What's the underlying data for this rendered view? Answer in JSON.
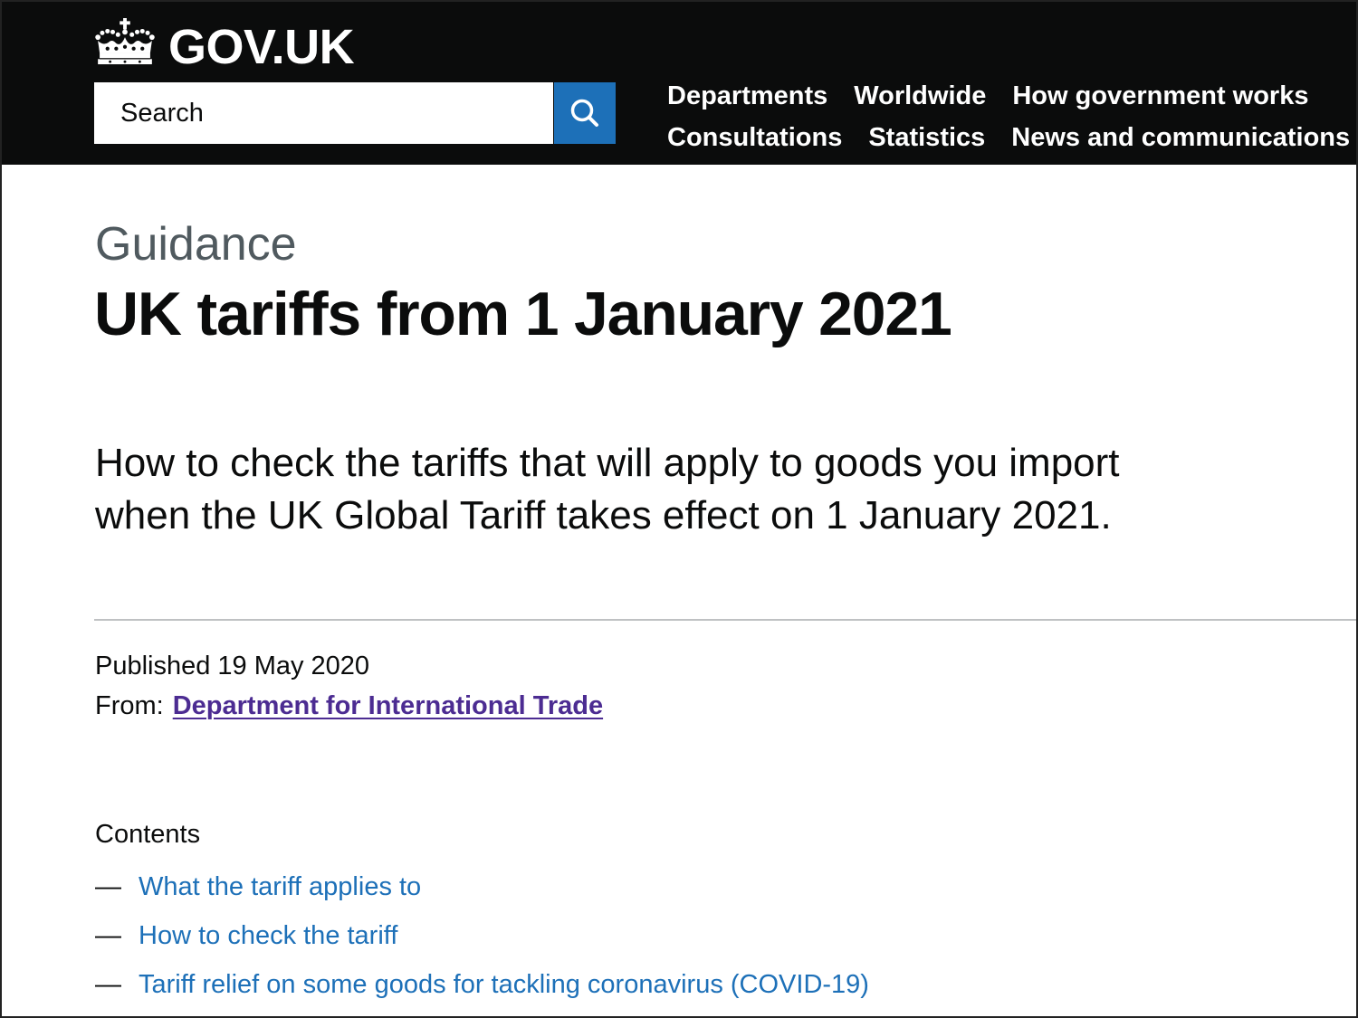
{
  "header": {
    "logo": {
      "text": "GOV.UK",
      "icon": "crown-icon"
    },
    "search": {
      "placeholder": "Search",
      "button_icon": "search-icon"
    },
    "nav": {
      "items": [
        {
          "label": "Departments"
        },
        {
          "label": "Worldwide"
        },
        {
          "label": "How government works"
        },
        {
          "label": "Consultations"
        },
        {
          "label": "Statistics"
        },
        {
          "label": "News and communications"
        }
      ]
    }
  },
  "main": {
    "document_type": "Guidance",
    "title": "UK tariffs from 1 January 2021",
    "description": "How to check the tariffs that will apply to goods you import when the UK Global Tariff takes effect on 1 January 2021.",
    "metadata": {
      "published_label": "Published",
      "published_date": "19 May 2020",
      "from_label": "From:",
      "from_organisation": "Department for International Trade"
    },
    "contents": {
      "heading": "Contents",
      "marker": "—",
      "items": [
        {
          "label": "What the tariff applies to"
        },
        {
          "label": "How to check the tariff"
        },
        {
          "label": "Tariff relief on some goods for tackling coronavirus (COVID-19)"
        }
      ]
    }
  },
  "colors": {
    "header_background": "#0b0c0c",
    "search_button": "#1d70b8",
    "link": "#1d70b8",
    "organisation_link": "#4c2c92",
    "secondary_text": "#505a5f",
    "text": "#0b0c0c",
    "divider": "#bfc1c3"
  }
}
